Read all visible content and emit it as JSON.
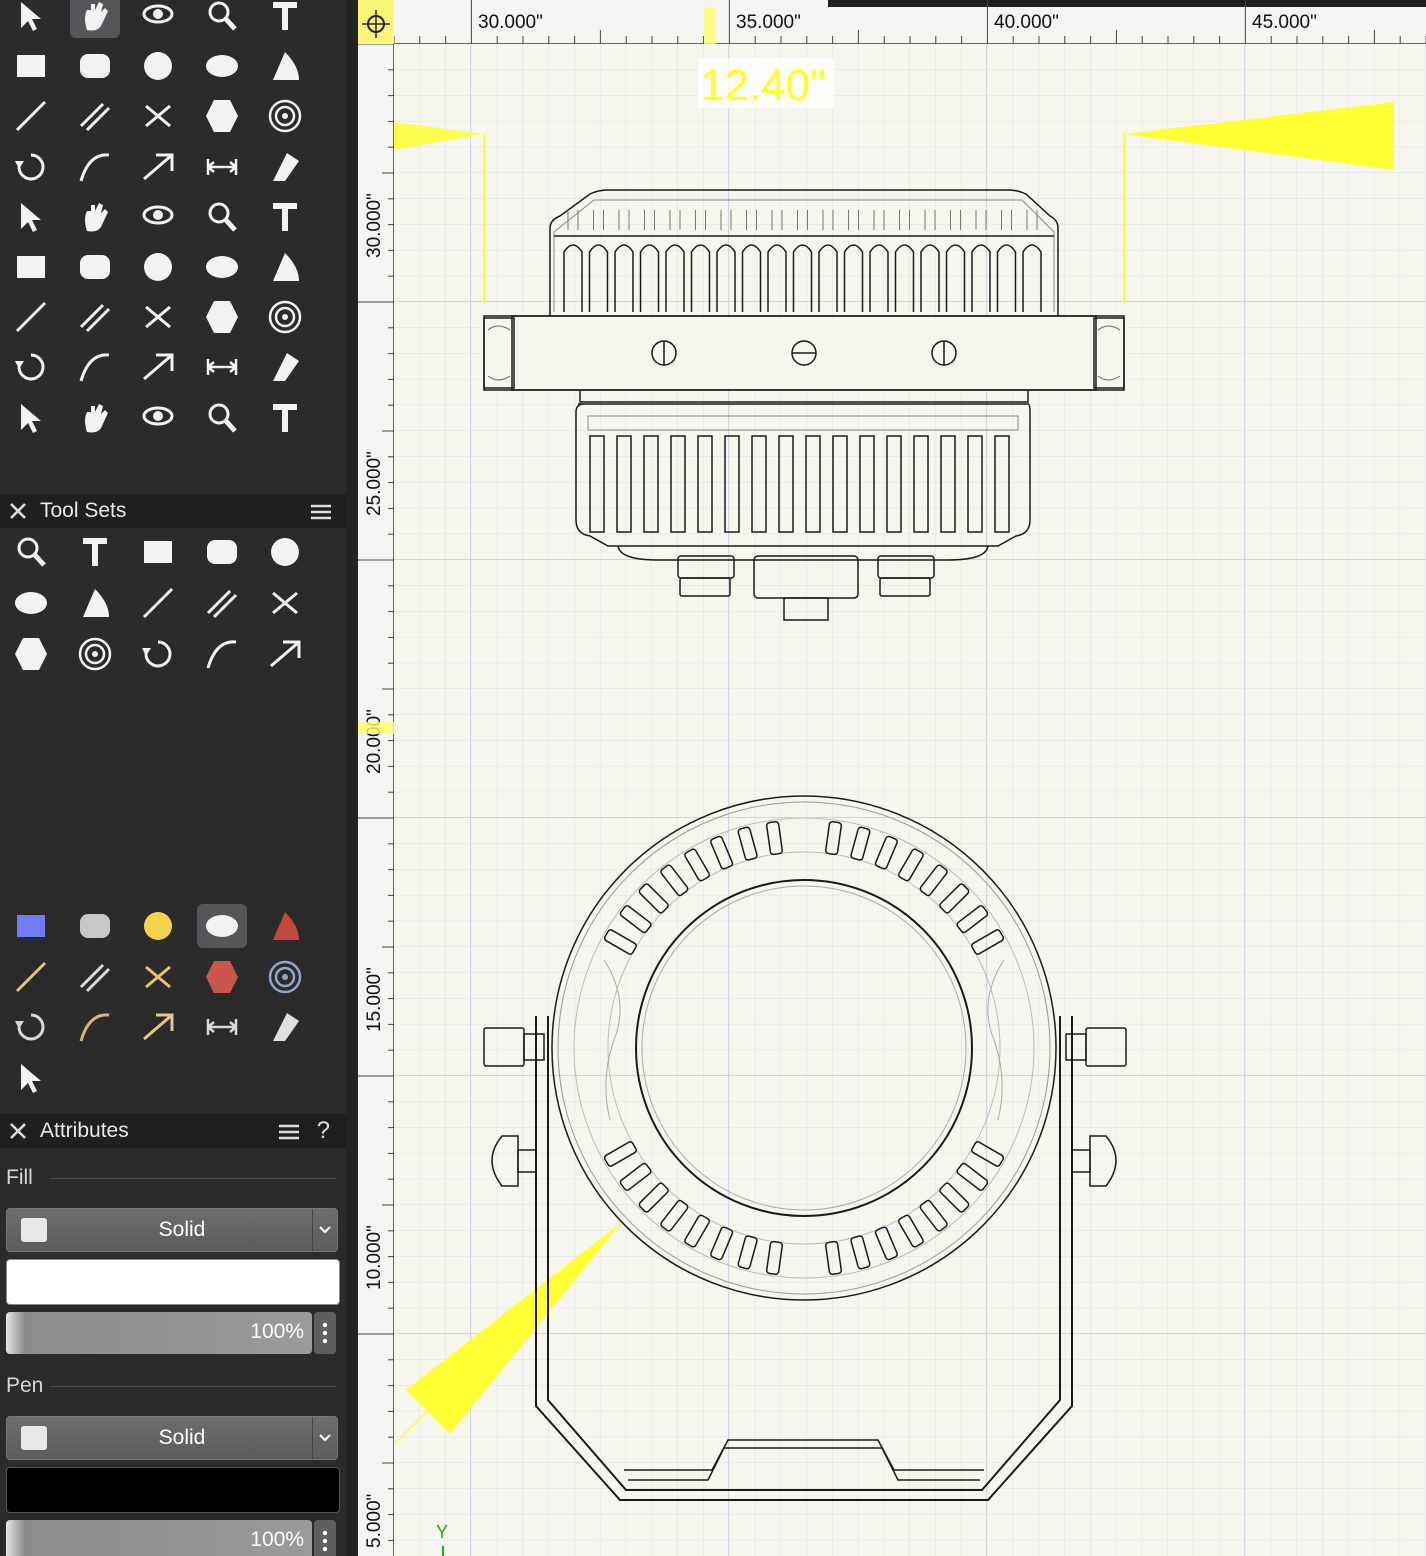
{
  "tools_primary": [
    "selection-tool-icon",
    "pan-tool-icon",
    "flyover-tool-icon",
    "zoom-tool-icon",
    "text-tool-icon",
    "callout-tool-icon",
    "locus-tool-icon",
    "3d-locus-tool-icon",
    "line-tool-icon",
    "double-line-tool-icon",
    "rectangle-tool-icon",
    "rounded-rectangle-tool-icon",
    "circle-tool-icon",
    "oval-tool-icon",
    "arc-tool-icon",
    "freehand-tool-icon",
    "polyline-tool-icon",
    "polygon-tool-icon",
    "double-line-polygon-tool-icon",
    "regular-polygon-tool-icon",
    "spiral-tool-icon",
    "eyedropper-tool-icon",
    "magic-wand-tool-icon",
    "visibility-tool-icon",
    "reshape-tool-icon",
    "move-by-points-tool-icon",
    "rotate-tool-icon",
    "mirror-tool-icon",
    "trim-tool-icon",
    "clip-tool-icon",
    "split-tool-icon",
    "fillet-tool-icon",
    "chamfer-tool-icon",
    "connect-combine-tool-icon",
    "eraser-tool-icon",
    "offset-tool-icon",
    "dimension-tool-icon",
    "angular-dimension-tool-icon",
    "radial-dimension-tool-icon",
    "arc-length-tool-icon",
    "diameter-dimension-tool-icon",
    "tape-measure-tool-icon",
    "protractor-tool-icon",
    "attribute-mapping-tool-icon",
    "repair-tool-icon"
  ],
  "tool_sets": {
    "title": "Tool Sets",
    "tools": [
      "truss-tool-icon",
      "hoist-tool-icon",
      "lighting-position-tool-icon",
      "straight-truss-tool-icon",
      "curved-truss-tool-icon",
      "pipe-tool-icon",
      "truss-crossing-tool-icon",
      "truss-cross-tool-icon",
      "chain-hoist-tool-icon",
      "truss-cube-tool-icon",
      "weight-tool-icon",
      "bumper-tool-icon",
      "bridle-tool-icon",
      "rigging-point-tool-icon",
      "distributed-load-tool-icon"
    ]
  },
  "workspace_tabs": [
    "video-tools-icon",
    "lighting-instrument-icon",
    "electrical-tools-icon",
    "rigging-tools-icon",
    "stage-tools-icon",
    "cable-tools-icon",
    "door-frame-icon",
    "hvac-tools-icon",
    "house-tools-icon",
    "glass-panel-icon",
    "camera-tools-icon",
    "cabinet-tools-icon",
    "measure-tools-icon",
    "truss-section-icon",
    "fastener-tools-icon",
    "settings-gear-icon"
  ],
  "attributes": {
    "title": "Attributes",
    "help": "?",
    "fill_label": "Fill",
    "fill_style": "Solid",
    "fill_color": "#ffffff",
    "fill_opacity": "100%",
    "pen_label": "Pen",
    "pen_style": "Solid",
    "pen_color": "#000000",
    "pen_opacity": "100%"
  },
  "ruler": {
    "top_labels": [
      "30.000\"",
      "35.000\"",
      "40.000\"",
      "45.000\""
    ],
    "left_labels": [
      "30.000\"",
      "25.000\"",
      "20.000\"",
      "15.000\"",
      "10.000\"",
      "5.000\""
    ]
  },
  "dimension_readout": "12.40\"",
  "axis_label": "Y",
  "colors": {
    "canvas_bg": "#f6f6ee",
    "grid_minor": "#d6e1ef",
    "grid_major": "#c3d2e6",
    "highlight": "#ffff33"
  }
}
